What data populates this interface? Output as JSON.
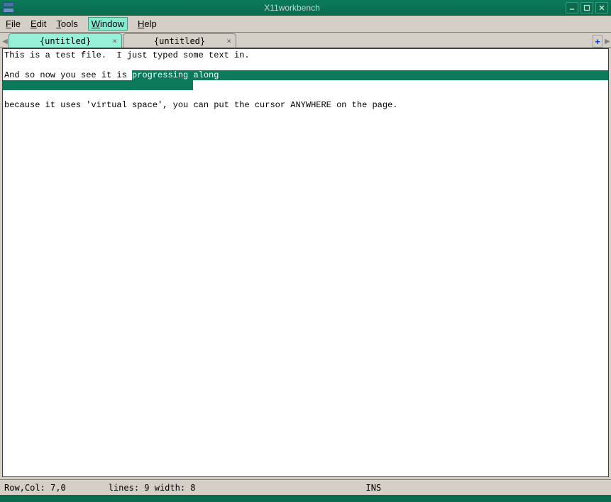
{
  "window": {
    "title": "X11workbench"
  },
  "menu": {
    "file": "File",
    "edit": "Edit",
    "tools": "Tools",
    "window": "Window",
    "help": "Help"
  },
  "tabs": [
    {
      "label": "{untitled}",
      "active": true
    },
    {
      "label": "{untitled}",
      "active": false
    }
  ],
  "document": {
    "line1": "This is a test file.  I just typed some text in.",
    "line2": "",
    "line3_pre": "And so now you see it is ",
    "line3_sel": "progressing along",
    "line5": "",
    "line6": "because it uses 'virtual space', you can put the cursor ANYWHERE on the page."
  },
  "status": {
    "rowcol": "Row,Col: 7,0",
    "lines": "lines:  9  width:  8",
    "mode": "INS"
  }
}
